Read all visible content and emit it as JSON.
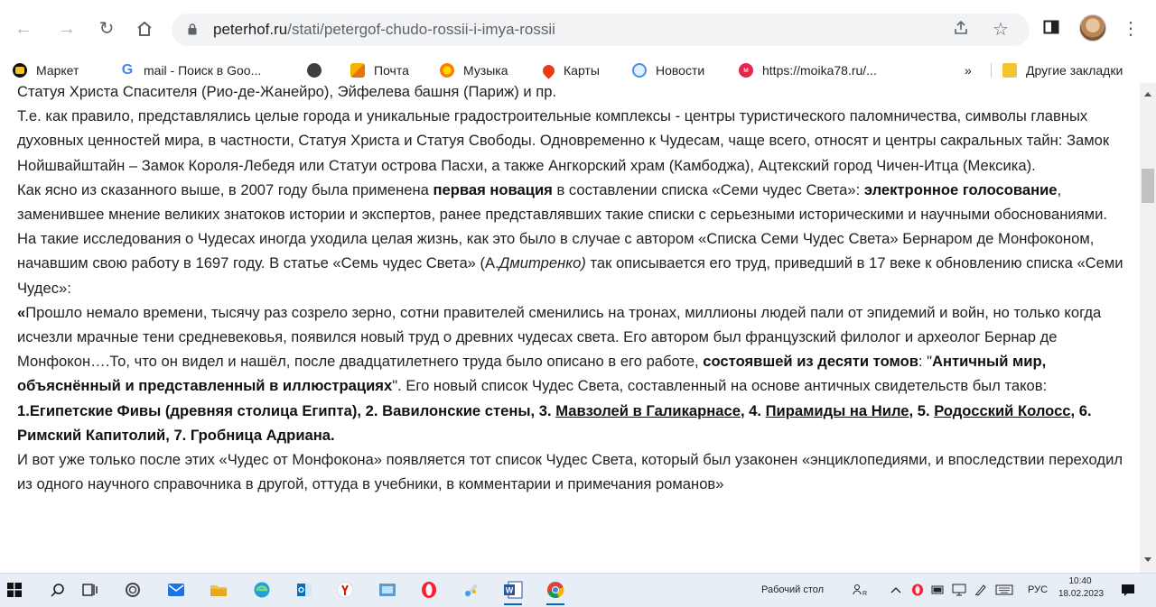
{
  "browser": {
    "url_domain": "peterhof.ru",
    "url_path": "/stati/petergof-chudo-rossii-i-imya-rossii",
    "icons": [
      "back-icon",
      "forward-icon",
      "reload-icon",
      "home-icon",
      "lock-icon",
      "share-icon",
      "star-icon",
      "sidepanel-icon",
      "avatar",
      "menu-icon"
    ]
  },
  "bookmarks": {
    "items": [
      {
        "label": "Маркет",
        "color": "#f5c518"
      },
      {
        "label": "mail - Поиск в Goo...",
        "color": "#4285f4"
      },
      {
        "label": "",
        "color": "#5f6368"
      },
      {
        "label": "Почта",
        "color": "#f9b100"
      },
      {
        "label": "Музыка",
        "color": "#ff7a00"
      },
      {
        "label": "Карты",
        "color": "#f03a17"
      },
      {
        "label": "Новости",
        "color": "#4a90e2"
      },
      {
        "label": "https://moika78.ru/...",
        "color": "#e5254b"
      }
    ],
    "more": "»",
    "other": "Другие закладки"
  },
  "article": {
    "p0": "Статуя Христа Спасителя (Рио-де-Жанейро), Эйфелева башня (Париж) и пр.",
    "p1": "Т.е. как правило, представлялись целые города и уникальные градостроительные комплексы - центры туристического паломничества, символы главных духовных ценностей мира, в частности, Статуя Христа и Статуя Свободы. Одновременно к Чудесам, чаще всего, относят и центры сакральных тайн: Замок Нойшвайштайн – Замок Короля-Лебедя или Статуи острова Пасхи, а также Ангкорский храм (Камбоджа), Ацтекский город Чичен-Итца (Мексика).",
    "p2a": "Как ясно из сказанного выше, в 2007 году была применена ",
    "p2b": "первая новация",
    "p2c": " в составлении списка «Семи чудес Света»: ",
    "p2d": "электронное голосование",
    "p2e": ", заменившее мнение великих знатоков истории и экспертов, ранее представлявших такие списки с серьезными историческими и научными обоснованиями. На такие исследования о Чудесах иногда уходила целая жизнь, как это было в случае с автором «Списка Семи Чудес Света» Бернаром де Монфоконом, начавшим свою работу в 1697 году. В статье «Семь чудес Света» (А.",
    "p2f": "Дмитренко)",
    "p2g": " так описывается его труд, приведший в 17 веке к обновлению списка «Семи Чудес»:",
    "p3a": "«",
    "p3b": "Прошло немало времени, тысячу раз созрело зерно, сотни правителей сменились на тронах, миллионы людей пали от эпидемий и войн, но только когда исчезли мрачные тени средневековья, появился новый труд о древних чудесах света. Его автором был французский филолог и археолог Бернар де Монфокон….То, что он видел и нашёл, после двадцатилетнего труда было описано в его работе, ",
    "p3c": "состоявшей из десяти томов",
    "p3d": ": \"",
    "p3e": "Античный мир, объяснённый и представленный в иллюстрациях",
    "p3f": "\". Его новый список Чудес Света, составленный на основе античных свидетельств был таков:",
    "list_a": "1.Египетские Фивы (древняя столица Египта), 2. Вавилонские стены, 3. ",
    "list_b": "Мавзолей в Галикарнасе",
    "list_c": ", 4. ",
    "list_d": "Пирамиды на Ниле",
    "list_e": ", 5. ",
    "list_f": "Родосский Колосс",
    "list_g": ", 6. Римский Капитолий, 7. Гробница Адриана.",
    "p4": "И вот уже только после этих «Чудес от Монфокона» появляется тот список Чудес Света, который был узаконен «энциклопедиями, и впоследствии переходил из одного научного справочника в другой, оттуда в учебники, в комментарии и примечания романов»"
  },
  "taskbar": {
    "desktop_label": "Рабочий стол",
    "lang": "РУС",
    "time": "10:40",
    "date": "18.02.2023"
  }
}
